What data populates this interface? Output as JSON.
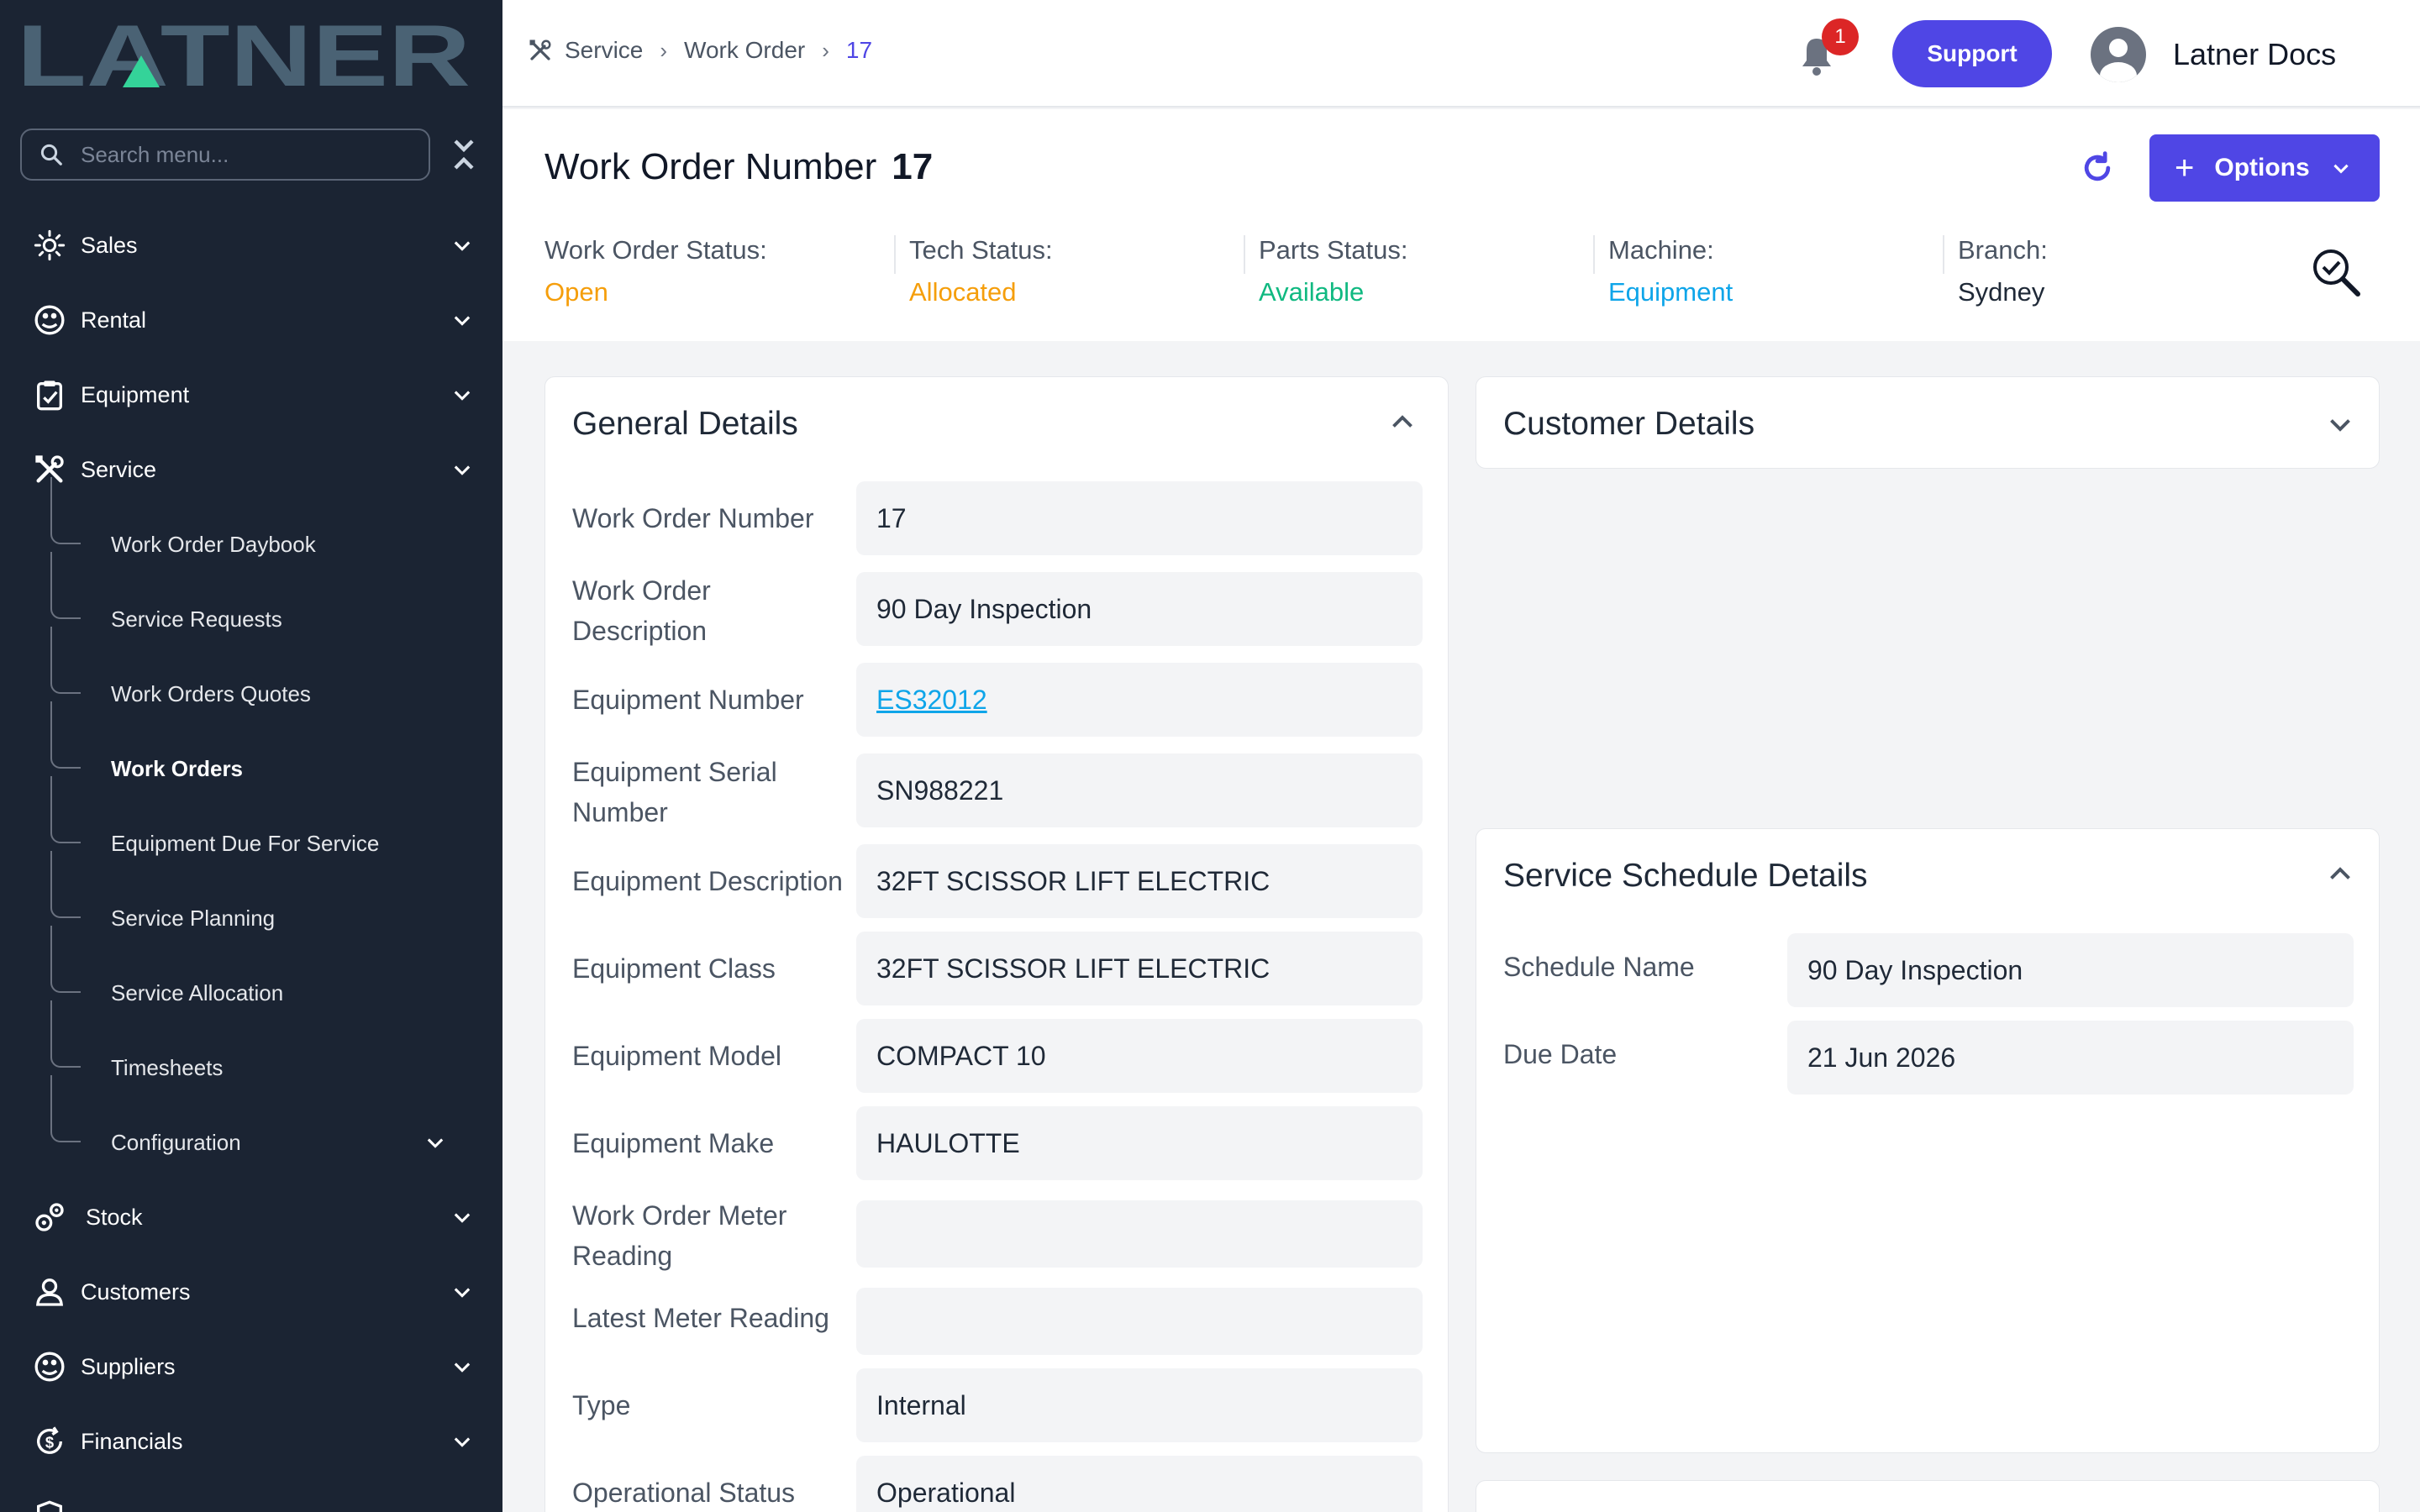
{
  "brand": {
    "logo_text": "LATNER"
  },
  "sidebar": {
    "search_placeholder": "Search menu...",
    "items": [
      {
        "label": "Sales"
      },
      {
        "label": "Rental"
      },
      {
        "label": "Equipment"
      },
      {
        "label": "Service"
      },
      {
        "label": "Stock"
      },
      {
        "label": "Customers"
      },
      {
        "label": "Suppliers"
      },
      {
        "label": "Financials"
      }
    ],
    "service_sub_items": [
      {
        "label": "Work Order Daybook"
      },
      {
        "label": "Service Requests"
      },
      {
        "label": "Work Orders Quotes"
      },
      {
        "label": "Work Orders",
        "active": true
      },
      {
        "label": "Equipment Due For Service"
      },
      {
        "label": "Service Planning"
      },
      {
        "label": "Service Allocation"
      },
      {
        "label": "Timesheets"
      },
      {
        "label": "Configuration"
      }
    ]
  },
  "topbar": {
    "breadcrumb": [
      "Service",
      "Work Order",
      "17"
    ],
    "notification_count": "1",
    "support_label": "Support",
    "user_name": "Latner Docs"
  },
  "header": {
    "title": "Work Order Number",
    "number": "17",
    "options_label": "Options",
    "statuses": [
      {
        "label": "Work Order Status:",
        "value": "Open",
        "color": "#f59e0b"
      },
      {
        "label": "Tech Status:",
        "value": "Allocated",
        "color": "#f59e0b"
      },
      {
        "label": "Parts Status:",
        "value": "Available",
        "color": "#10b981"
      },
      {
        "label": "Machine:",
        "value": "Equipment",
        "color": "#0ea5e9"
      },
      {
        "label": "Branch:",
        "value": "Sydney",
        "color": "#1f2937"
      }
    ]
  },
  "general_details": {
    "title": "General Details",
    "fields": [
      {
        "label": "Work Order Number",
        "value": "17"
      },
      {
        "label": "Work Order Description",
        "value": "90 Day Inspection"
      },
      {
        "label": "Equipment Number",
        "value": "ES32012"
      },
      {
        "label": "Equipment Serial Number",
        "value": "SN988221"
      },
      {
        "label": "Equipment Description",
        "value": "32FT SCISSOR LIFT ELECTRIC"
      },
      {
        "label": "Equipment Class",
        "value": "32FT SCISSOR LIFT ELECTRIC"
      },
      {
        "label": "Equipment Model",
        "value": "COMPACT 10"
      },
      {
        "label": "Equipment Make",
        "value": "HAULOTTE"
      },
      {
        "label": "Work Order Meter Reading",
        "value": ""
      },
      {
        "label": "Latest Meter Reading",
        "value": ""
      },
      {
        "label": "Type",
        "value": "Internal"
      },
      {
        "label": "Operational Status",
        "value": "Operational"
      }
    ]
  },
  "customer_details": {
    "title": "Customer Details"
  },
  "service_schedule": {
    "title": "Service Schedule Details",
    "fields": [
      {
        "label": "Schedule Name",
        "value": "90 Day Inspection"
      },
      {
        "label": "Due Date",
        "value": "21 Jun 2026"
      }
    ]
  },
  "colors": {
    "accent": "#4f46e5",
    "sidebar_bg": "#1b2433",
    "logo_slate": "#4a6274",
    "logo_green": "#34d399"
  }
}
